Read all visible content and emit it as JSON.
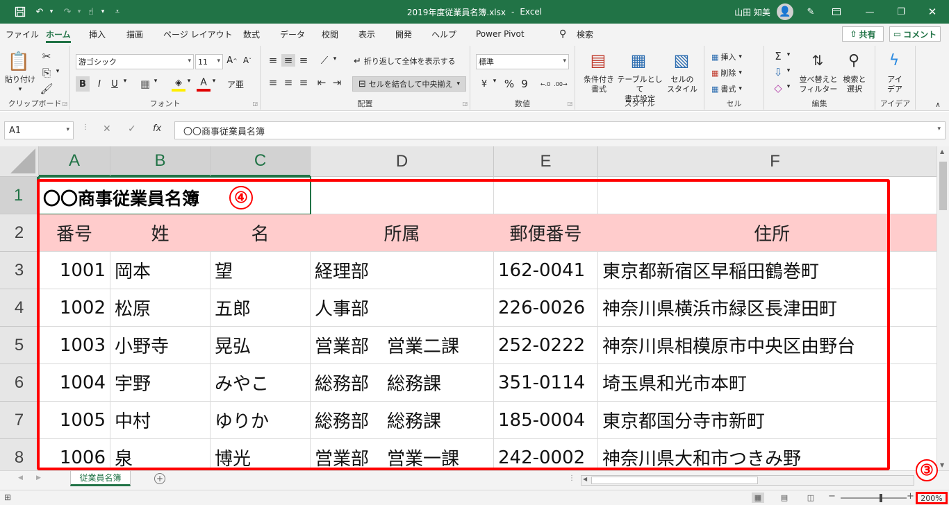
{
  "titlebar": {
    "filename": "2019年度従業員名簿.xlsx",
    "separator": "-",
    "app": "Excel",
    "user": "山田 知美"
  },
  "menu": {
    "tabs": [
      "ファイル",
      "ホーム",
      "挿入",
      "描画",
      "ページ レイアウト",
      "数式",
      "データ",
      "校閲",
      "表示",
      "開発",
      "ヘルプ",
      "Power Pivot"
    ],
    "active": "ホーム",
    "search": "検索",
    "share": "共有",
    "comment": "コメント"
  },
  "ribbon": {
    "clipboard": {
      "paste": "貼り付け",
      "label": "クリップボード"
    },
    "font": {
      "name": "游ゴシック",
      "size": "11",
      "label": "フォント"
    },
    "alignment": {
      "wrap": "折り返して全体を表示する",
      "merge": "セルを結合して中央揃え",
      "label": "配置"
    },
    "number": {
      "format": "標準",
      "label": "数値"
    },
    "styles": {
      "conditional": "条件付き\n書式",
      "table": "テーブルとして\n書式設定",
      "cell": "セルの\nスタイル",
      "label": "スタイル"
    },
    "cells": {
      "insert": "挿入",
      "delete": "削除",
      "format": "書式",
      "label": "セル"
    },
    "editing": {
      "sort": "並べ替えと\nフィルター",
      "find": "検索と\n選択",
      "label": "編集"
    },
    "ideas": {
      "btn": "アイ\nデア",
      "label": "アイデア"
    }
  },
  "formula_bar": {
    "name_box": "A1",
    "fx": "fx",
    "value": "〇〇商事従業員名簿"
  },
  "sheet": {
    "columns": [
      "A",
      "B",
      "C",
      "D",
      "E",
      "F"
    ],
    "rows": [
      "1",
      "2",
      "3",
      "4",
      "5",
      "6",
      "7",
      "8"
    ],
    "title": "〇〇商事従業員名簿",
    "headers": [
      "番号",
      "姓",
      "名",
      "所属",
      "郵便番号",
      "住所"
    ],
    "data": [
      [
        "1001",
        "岡本",
        "望",
        "経理部",
        "162-0041",
        "東京都新宿区早稲田鶴巻町"
      ],
      [
        "1002",
        "松原",
        "五郎",
        "人事部",
        "226-0026",
        "神奈川県横浜市緑区長津田町"
      ],
      [
        "1003",
        "小野寺",
        "晃弘",
        "営業部　営業二課",
        "252-0222",
        "神奈川県相模原市中央区由野台"
      ],
      [
        "1004",
        "宇野",
        "みやこ",
        "総務部　総務課",
        "351-0114",
        "埼玉県和光市本町"
      ],
      [
        "1005",
        "中村",
        "ゆりか",
        "総務部　総務課",
        "185-0004",
        "東京都国分寺市新町"
      ],
      [
        "1006",
        "泉",
        "博光",
        "営業部　営業一課",
        "242-0002",
        "神奈川県大和市つきみ野"
      ]
    ]
  },
  "annotations": {
    "title_marker": "④",
    "zoom_marker": "③"
  },
  "sheet_tab": "従業員名簿",
  "status": {
    "zoom": "200%"
  }
}
